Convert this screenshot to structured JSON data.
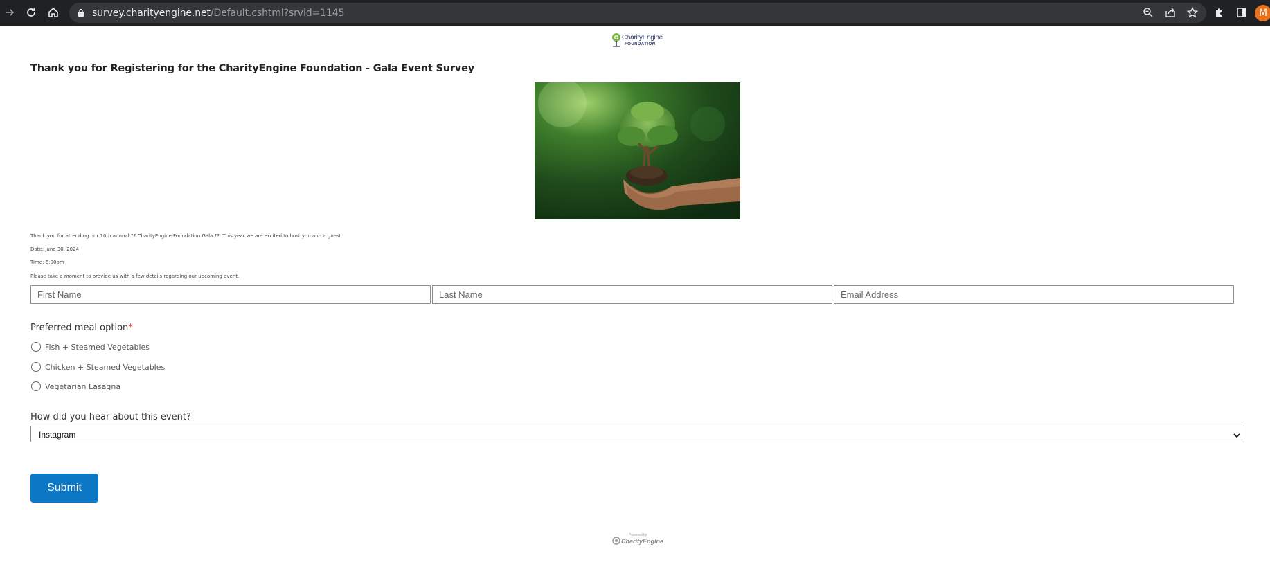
{
  "browser": {
    "url_host": "survey.charityengine.net",
    "url_path": "/Default.cshtml?srvid=1145",
    "profile_initial": "M"
  },
  "logo": {
    "name": "CharityEngine",
    "sub": "FOUNDATION"
  },
  "page": {
    "title": "Thank you for Registering for the CharityEngine Foundation - Gala Event Survey",
    "intro": "Thank you for attending our 10th annual ?? CharityEngine Foundation Gala ??. This year we are excited to host you and a guest.",
    "date": "Date: June 30, 2024",
    "time": "Time: 6:00pm",
    "instructions": "Please take a moment to provide us with a few details regarding our upcoming event."
  },
  "form": {
    "first_name_placeholder": "First Name",
    "last_name_placeholder": "Last Name",
    "email_placeholder": "Email Address",
    "meal_label": "Preferred meal option",
    "required_mark": "*",
    "meal_options": [
      "Fish + Steamed Vegetables",
      "Chicken + Steamed Vegetables",
      "Vegetarian Lasagna"
    ],
    "source_label": "How did you hear about this event?",
    "source_selected": "Instagram",
    "submit_label": "Submit"
  },
  "footer": {
    "powered_by": "Powered by",
    "brand": "CharityEngine"
  },
  "colors": {
    "accent": "#0b77c5",
    "browser_bg": "#202124",
    "required": "#dd3333"
  }
}
